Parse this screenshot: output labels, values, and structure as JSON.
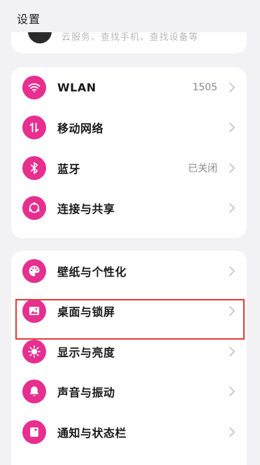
{
  "header": {
    "title": "设置"
  },
  "previous_card": {
    "text": "云服务、查找手机、查找设备等"
  },
  "network_group": {
    "items": [
      {
        "label": "WLAN",
        "value": "1505",
        "icon": "wifi-icon"
      },
      {
        "label": "移动网络",
        "value": "",
        "icon": "mobile-data-icon"
      },
      {
        "label": "蓝牙",
        "value": "已关闭",
        "icon": "bluetooth-icon"
      },
      {
        "label": "连接与共享",
        "value": "",
        "icon": "share-icon"
      }
    ]
  },
  "display_group": {
    "items": [
      {
        "label": "壁纸与个性化",
        "icon": "palette-icon"
      },
      {
        "label": "桌面与锁屏",
        "icon": "image-icon"
      },
      {
        "label": "显示与亮度",
        "icon": "brightness-icon"
      },
      {
        "label": "声音与振动",
        "icon": "bell-icon"
      },
      {
        "label": "通知与状态栏",
        "icon": "notification-icon"
      }
    ]
  },
  "colors": {
    "accent": "#e62f8f",
    "background": "#f2f2f4",
    "card": "#ffffff",
    "highlight_box": "#e23b3b"
  }
}
